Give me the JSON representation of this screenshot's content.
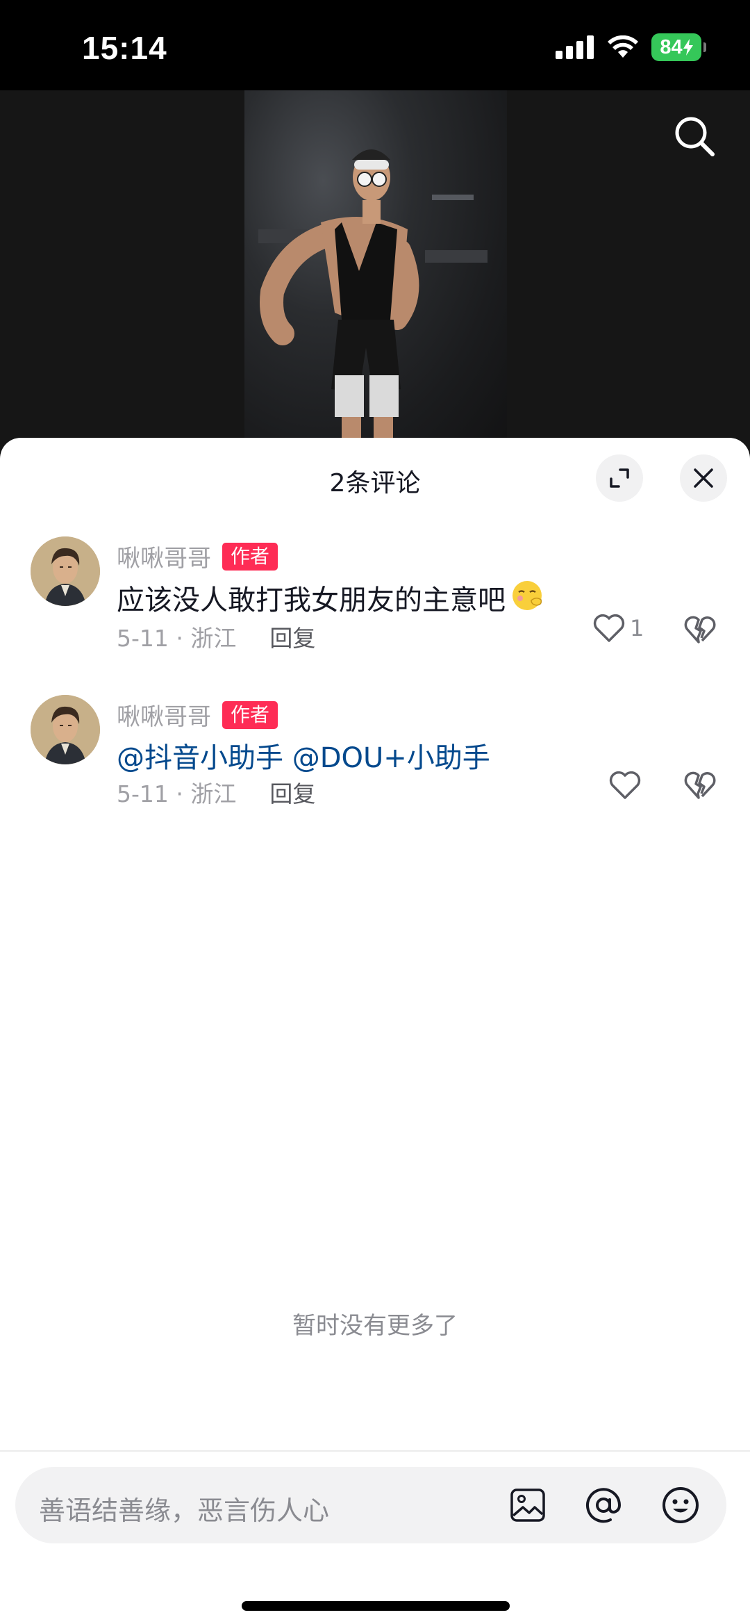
{
  "status_bar": {
    "time": "15:14",
    "battery": "84"
  },
  "comments_header": {
    "title": "2条评论"
  },
  "comments": [
    {
      "username": "啾啾哥哥",
      "badge": "作者",
      "text": "应该没人敢打我女朋友的主意吧",
      "emoji": "🤭",
      "date_location": "5-11 · 浙江",
      "reply_label": "回复",
      "like_count": "1"
    },
    {
      "username": "啾啾哥哥",
      "badge": "作者",
      "text": "@抖音小助手 @DOU+小助手",
      "date_location": "5-11 · 浙江",
      "reply_label": "回复",
      "like_count": ""
    }
  ],
  "footer": {
    "no_more": "暂时没有更多了"
  },
  "input": {
    "placeholder": "善语结善缘，恶言伤人心"
  },
  "colors": {
    "accent_red": "#fe2c55",
    "mention_blue": "#04498d",
    "battery_green": "#35c759"
  }
}
